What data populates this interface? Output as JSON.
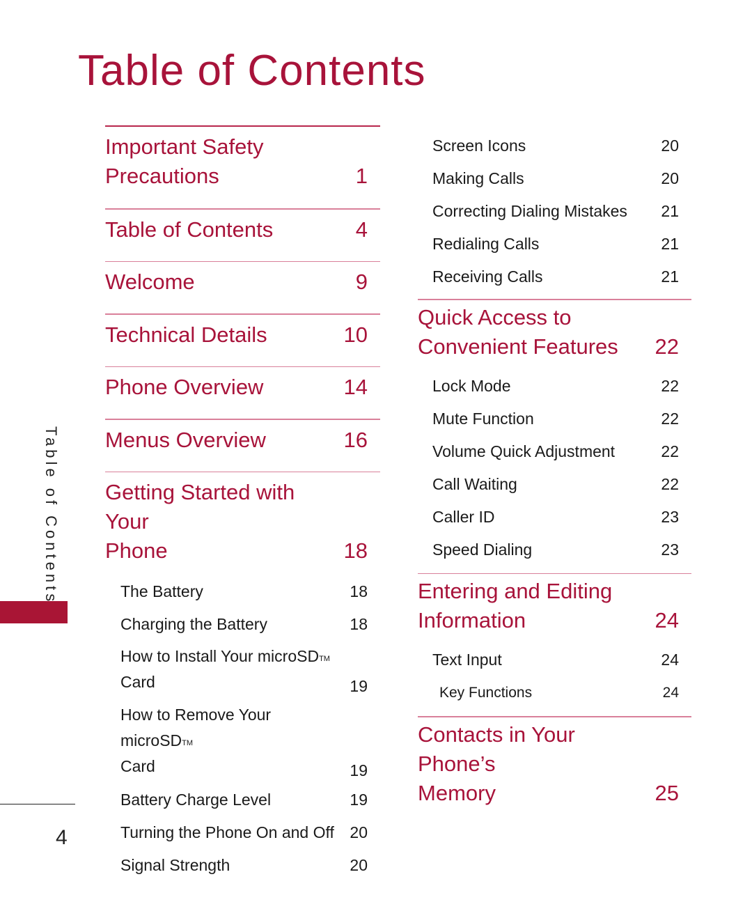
{
  "page": {
    "title": "Table of Contents",
    "side_label": "Table of Contents",
    "page_number": "4",
    "accent_color": "#a8133a"
  },
  "left_column": {
    "sections": [
      {
        "title": "Important Safety Precautions",
        "line1": "Important Safety",
        "line2": "Precautions",
        "page": "1"
      },
      {
        "title": "Table of Contents",
        "page": "4"
      },
      {
        "title": "Welcome",
        "page": "9"
      },
      {
        "title": "Technical Details",
        "page": "10"
      },
      {
        "title": "Phone Overview",
        "page": "14"
      },
      {
        "title": "Menus Overview",
        "page": "16"
      },
      {
        "title": "Getting Started with Your Phone",
        "line1": "Getting Started with Your",
        "line2": "Phone",
        "page": "18"
      }
    ],
    "getting_started_items": [
      {
        "title": "The Battery",
        "page": "18"
      },
      {
        "title": "Charging the Battery",
        "page": "18"
      },
      {
        "title": "How to Install Your microSD™ Card",
        "line1": "How to Install Your microSD",
        "tm": "TM",
        "line2": "Card",
        "page": "19"
      },
      {
        "title": "How to Remove Your microSD™ Card",
        "line1": "How to Remove Your microSD",
        "tm": "TM",
        "line2": "Card",
        "page": "19"
      },
      {
        "title": "Battery Charge Level",
        "page": "19"
      },
      {
        "title": "Turning the Phone On and Off",
        "page": "20"
      },
      {
        "title": "Signal Strength",
        "page": "20"
      }
    ]
  },
  "right_column": {
    "continued_items": [
      {
        "title": "Screen Icons",
        "page": "20"
      },
      {
        "title": "Making Calls",
        "page": "20"
      },
      {
        "title": "Correcting Dialing Mistakes",
        "page": "21"
      },
      {
        "title": "Redialing Calls",
        "page": "21"
      },
      {
        "title": "Receiving Calls",
        "page": "21"
      }
    ],
    "quick_access": {
      "line1": "Quick Access to",
      "line2": "Convenient Features",
      "page": "22",
      "items": [
        {
          "title": "Lock Mode",
          "page": "22"
        },
        {
          "title": "Mute Function",
          "page": "22"
        },
        {
          "title": "Volume Quick Adjustment",
          "page": "22"
        },
        {
          "title": "Call Waiting",
          "page": "22"
        },
        {
          "title": "Caller ID",
          "page": "23"
        },
        {
          "title": "Speed Dialing",
          "page": "23"
        }
      ]
    },
    "entering_editing": {
      "line1": "Entering and Editing",
      "line2": "Information",
      "page": "24",
      "items": [
        {
          "title": "Text Input",
          "page": "24"
        },
        {
          "title": "Key Functions",
          "page": "24",
          "level": 3
        }
      ]
    },
    "contacts": {
      "line1": "Contacts in Your Phone’s",
      "line2": "Memory",
      "page": "25"
    }
  }
}
